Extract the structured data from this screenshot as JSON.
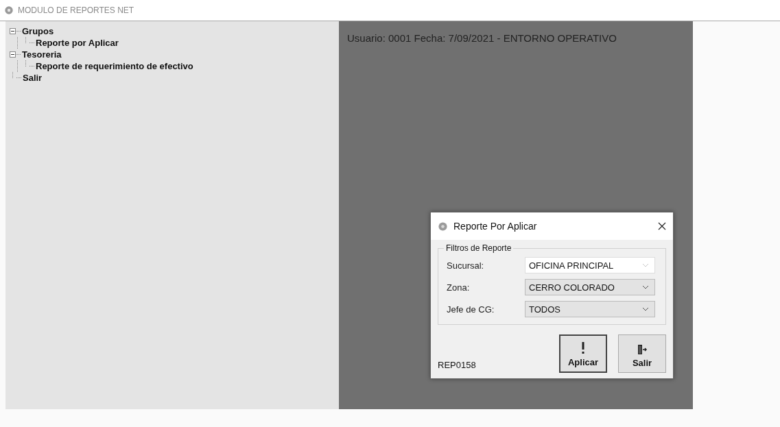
{
  "window": {
    "title": "MODULO DE REPORTES NET"
  },
  "tree": [
    {
      "label": "Grupos",
      "expanded": true,
      "children": [
        {
          "label": "Reporte por Aplicar"
        }
      ]
    },
    {
      "label": "Tesoreria",
      "expanded": true,
      "children": [
        {
          "label": "Reporte de requerimiento de efectivo"
        }
      ]
    },
    {
      "label": "Salir"
    }
  ],
  "status_text": "Usuario: 0001 Fecha: 7/09/2021 - ENTORNO OPERATIVO",
  "dialog": {
    "title": "Reporte Por Aplicar",
    "group_title": "Filtros de Reporte",
    "fields": [
      {
        "label": "Sucursal:",
        "value": "OFICINA PRINCIPAL",
        "disabled": true
      },
      {
        "label": "Zona:",
        "value": "CERRO COLORADO",
        "disabled": false
      },
      {
        "label": "Jefe de CG:",
        "value": "TODOS",
        "disabled": false
      }
    ],
    "code": "REP0158",
    "buttons": [
      {
        "kind": "apply",
        "label": "Aplicar",
        "selected": true
      },
      {
        "kind": "exit",
        "label": "Salir",
        "selected": false
      }
    ]
  }
}
